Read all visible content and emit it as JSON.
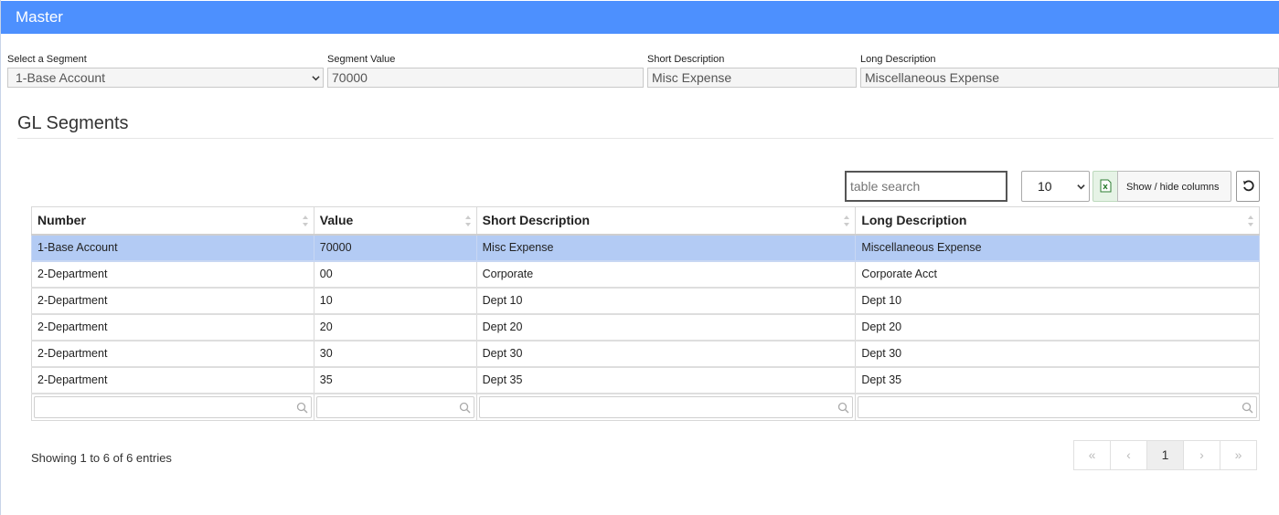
{
  "header": {
    "title": "Master"
  },
  "form": {
    "segment": {
      "label": "Select a Segment",
      "value": "1-Base Account"
    },
    "segment_value": {
      "label": "Segment Value",
      "value": "70000"
    },
    "short_description": {
      "label": "Short Description",
      "value": "Misc Expense"
    },
    "long_description": {
      "label": "Long Description",
      "value": "Miscellaneous Expense"
    }
  },
  "section": {
    "title": "GL Segments"
  },
  "toolbar": {
    "search_placeholder": "table search",
    "page_length": "10",
    "excel_icon": "excel-icon",
    "columns_label": "Show / hide columns",
    "reset_icon": "refresh-icon"
  },
  "table": {
    "columns": [
      "Number",
      "Value",
      "Short Description",
      "Long Description"
    ],
    "rows": [
      [
        "1-Base Account",
        "70000",
        "Misc Expense",
        "Miscellaneous Expense"
      ],
      [
        "2-Department",
        "00",
        "Corporate",
        "Corporate Acct"
      ],
      [
        "2-Department",
        "10",
        "Dept 10",
        "Dept 10"
      ],
      [
        "2-Department",
        "20",
        "Dept 20",
        "Dept 20"
      ],
      [
        "2-Department",
        "30",
        "Dept 30",
        "Dept 30"
      ],
      [
        "2-Department",
        "35",
        "Dept 35",
        "Dept 35"
      ]
    ],
    "selected_row": 0
  },
  "footer": {
    "info": "Showing 1 to 6 of 6 entries",
    "pager": {
      "first": "«",
      "prev": "‹",
      "current": "1",
      "next": "›",
      "last": "»"
    }
  },
  "colors": {
    "header": "#4d90fe",
    "selected_row": "#b3cbf4"
  }
}
